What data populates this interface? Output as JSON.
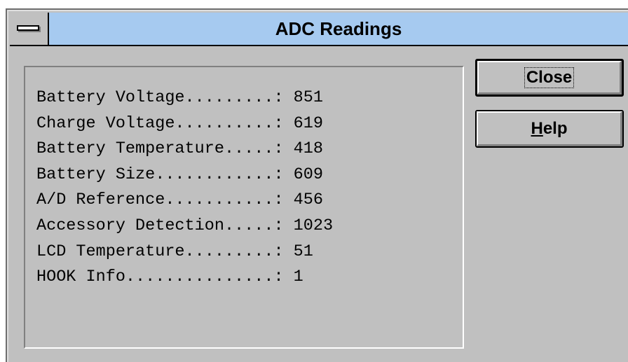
{
  "window": {
    "title": "ADC Readings",
    "colors": {
      "titlebar": "#a6caf0",
      "face": "#c0c0c0"
    }
  },
  "icons": {
    "system_menu": "system-menu-icon"
  },
  "readings": [
    {
      "label": "Battery Voltage.........: ",
      "value": "851"
    },
    {
      "label": "Charge Voltage..........: ",
      "value": "619"
    },
    {
      "label": "Battery Temperature.....: ",
      "value": "418"
    },
    {
      "label": "Battery Size............: ",
      "value": "609"
    },
    {
      "label": "A/D Reference...........: ",
      "value": "456"
    },
    {
      "label": "Accessory Detection.....: ",
      "value": "1023"
    },
    {
      "label": "LCD Temperature.........: ",
      "value": "51"
    },
    {
      "label": "HOOK Info...............: ",
      "value": "1"
    }
  ],
  "buttons": {
    "close_label": "Close",
    "help_mnemonic": "H",
    "help_rest": "elp"
  }
}
